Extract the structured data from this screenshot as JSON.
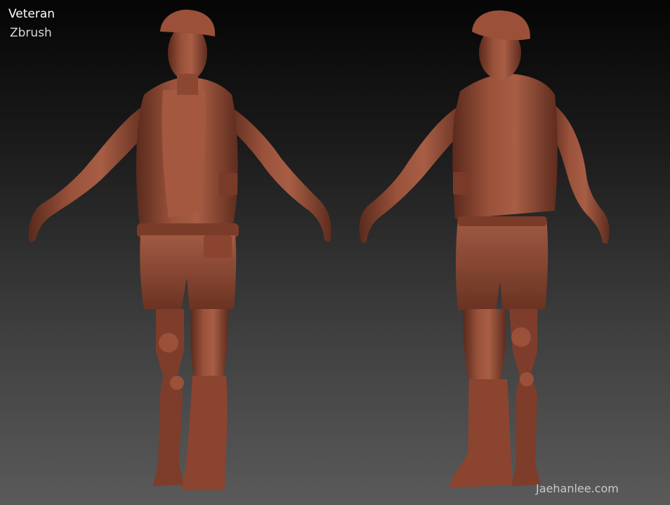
{
  "overlay": {
    "title": "Veteran",
    "subtitle": "Zbrush",
    "watermark": "Jaehanlee.com"
  },
  "colors": {
    "clay": "#8b4632",
    "clay_highlight": "#b06a52",
    "clay_shadow": "#5a2a1c",
    "background_top": "#050505",
    "background_bottom": "#5a5a5a"
  },
  "views": [
    "front-view",
    "back-view"
  ]
}
